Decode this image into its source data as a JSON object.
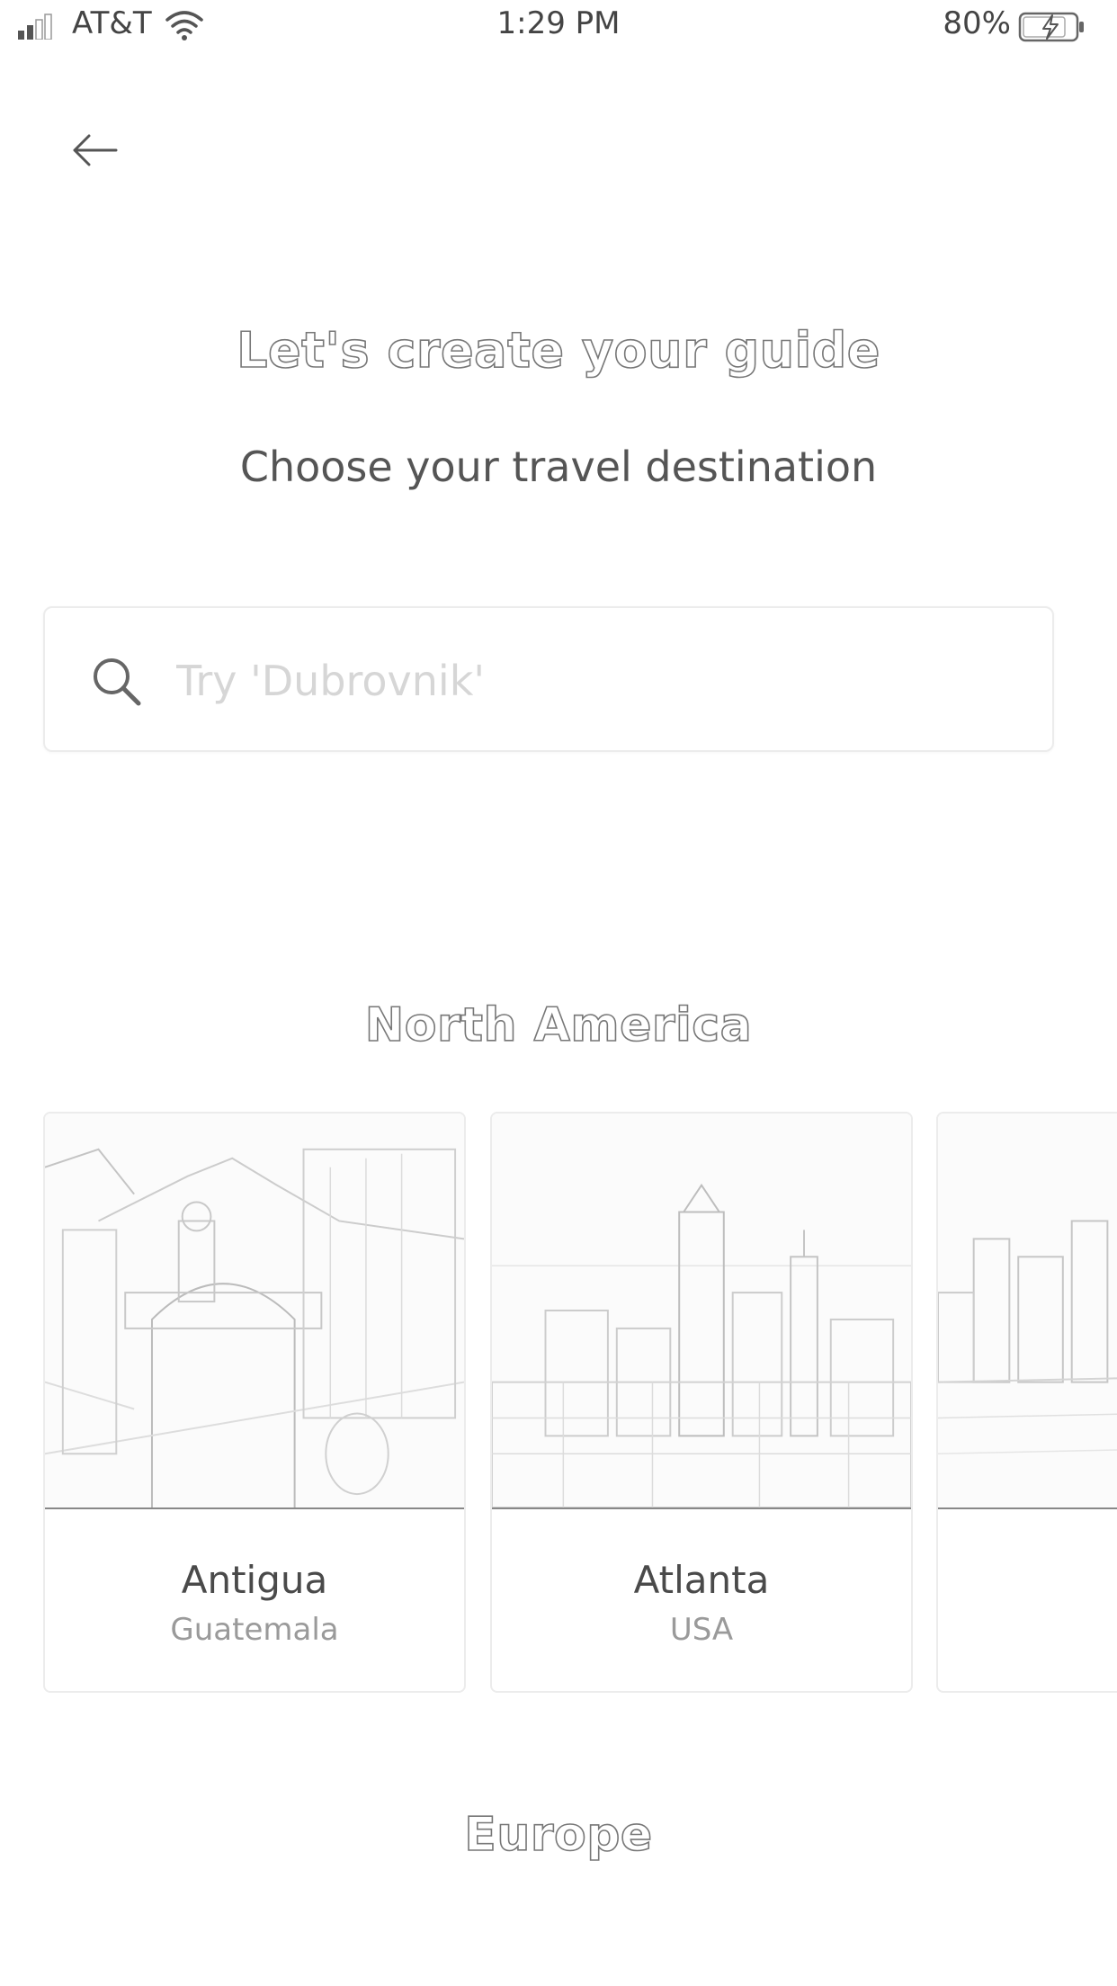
{
  "status_bar": {
    "carrier": "AT&T",
    "time": "1:29 PM",
    "battery": "80%"
  },
  "header": {
    "title": "Let's create your guide",
    "subtitle": "Choose your travel destination"
  },
  "search": {
    "placeholder": "Try 'Dubrovnik'",
    "value": ""
  },
  "sections": [
    {
      "title": "North America",
      "cards": [
        {
          "name": "Antigua",
          "country": "Guatemala"
        },
        {
          "name": "Atlanta",
          "country": "USA"
        },
        {
          "name": "",
          "country": ""
        }
      ]
    },
    {
      "title": "Europe"
    }
  ],
  "icons": {
    "back": "arrow-left-icon",
    "search": "search-icon",
    "wifi": "wifi-icon",
    "signal": "signal-icon",
    "battery": "battery-charging-icon"
  },
  "colors": {
    "text_primary": "#4a4a4a",
    "text_secondary": "#9a9a9a",
    "placeholder": "#d6d6d6",
    "border": "#ececec"
  }
}
